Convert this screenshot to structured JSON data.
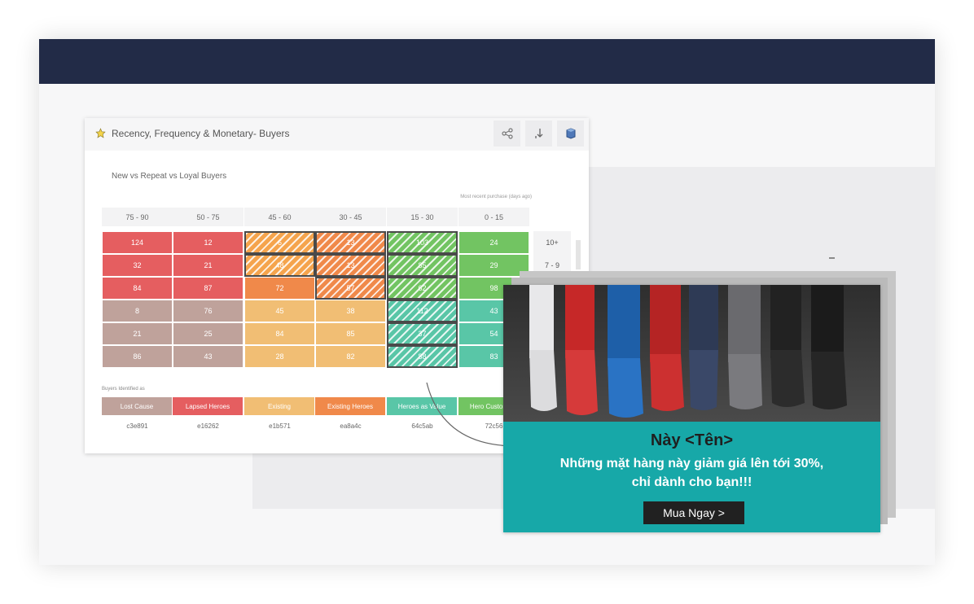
{
  "card": {
    "title": "Recency, Frequency & Monetary- Buyers",
    "subtitle": "New vs Repeat vs Loyal Buyers",
    "note": "Most recent purchase (days ago)",
    "icons": [
      "star-icon",
      "share-icon",
      "download-icon",
      "cube-icon"
    ]
  },
  "columns": [
    "75 - 90",
    "50 - 75",
    "45 - 60",
    "30 - 45",
    "15 - 30",
    "0 - 15"
  ],
  "rows": [
    {
      "label": "10+",
      "cells": [
        "124",
        "12",
        "6",
        "13",
        "103",
        "24"
      ]
    },
    {
      "label": "7 - 9",
      "cells": [
        "32",
        "21",
        "48",
        "13",
        "85",
        "29"
      ]
    },
    {
      "label": "",
      "cells": [
        "84",
        "87",
        "72",
        "57",
        "62",
        "98"
      ]
    },
    {
      "label": "",
      "cells": [
        "8",
        "76",
        "45",
        "38",
        "112",
        "43"
      ]
    },
    {
      "label": "",
      "cells": [
        "21",
        "25",
        "84",
        "85",
        "37",
        "54"
      ]
    },
    {
      "label": "",
      "cells": [
        "86",
        "43",
        "28",
        "82",
        "88",
        "83"
      ]
    }
  ],
  "colors": {
    "red": "#e55e60",
    "brown": "#bfa29b",
    "orange_light": "#f5a44d",
    "orange": "#f0894a",
    "teal": "#59c6a7",
    "green": "#72c462",
    "sand": "#f1be74",
    "promo_teal": "#17a8a8",
    "topbar": "#222b47"
  },
  "legend": {
    "title": "Buyers Identified as",
    "items": [
      {
        "label": "Lost Cause",
        "value": "c3e891",
        "color": "#bfa29b"
      },
      {
        "label": "Lapsed Heroes",
        "value": "e16262",
        "color": "#e55e60"
      },
      {
        "label": "Existing",
        "value": "e1b571",
        "color": "#f1be74"
      },
      {
        "label": "Existing Heroes",
        "value": "ea8a4c",
        "color": "#f0894a"
      },
      {
        "label": "Heroes as Value",
        "value": "64c5ab",
        "color": "#59c6a7"
      },
      {
        "label": "Hero Customers",
        "value": "72c56",
        "color": "#72c462"
      }
    ]
  },
  "promo": {
    "greeting": "Này <Tên>",
    "line1": "Những mặt hàng này giảm giá lên tới 30%,",
    "line2": "chỉ dành cho bạn!!!",
    "button": "Mua Ngay >",
    "image_icon": "sneakers-photo"
  }
}
